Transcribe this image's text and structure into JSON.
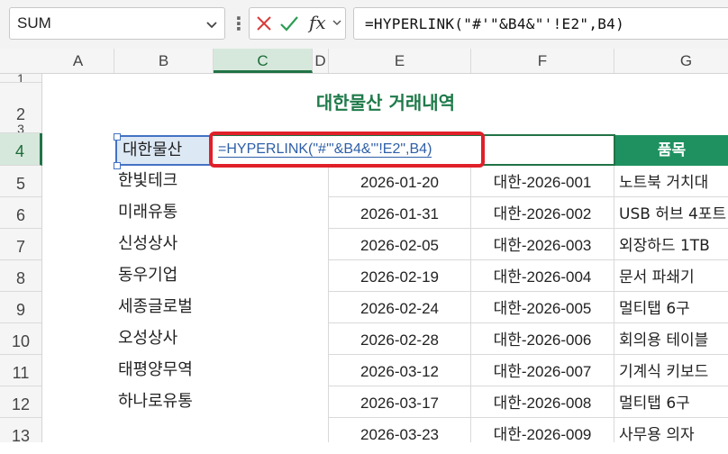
{
  "formula_bar": {
    "name_box": "SUM",
    "fx_label": "fx",
    "formula": "=HYPERLINK(\"#'\"&B4&\"'!E2\",B4)"
  },
  "columns": [
    "A",
    "B",
    "C",
    "D",
    "E",
    "F",
    "G"
  ],
  "selected_column": "C",
  "rows": [
    "1",
    "2",
    "3",
    "4",
    "5",
    "6",
    "7",
    "8",
    "9",
    "10",
    "11",
    "12",
    "13"
  ],
  "selected_row": "4",
  "sheet": {
    "title": "대한물산 거래내역",
    "b4": "대한물산",
    "c4_edit": {
      "part1": "=HYPERLINK(",
      "part2": "\"#'\"",
      "part3": "&B4&",
      "part4": "\"'!E2\"",
      "part5": ",B4)"
    },
    "g4_header": "품목",
    "names": [
      "한빛테크",
      "미래유통",
      "신성상사",
      "동우기업",
      "세종글로벌",
      "오성상사",
      "태평양무역",
      "하나로유통"
    ],
    "dates": [
      "2026-01-20",
      "2026-01-31",
      "2026-02-05",
      "2026-02-19",
      "2026-02-24",
      "2026-02-28",
      "2026-03-12",
      "2026-03-17",
      "2026-03-23"
    ],
    "codes": [
      "대한-2026-001",
      "대한-2026-002",
      "대한-2026-003",
      "대한-2026-004",
      "대한-2026-005",
      "대한-2026-006",
      "대한-2026-007",
      "대한-2026-008",
      "대한-2026-009"
    ],
    "items": [
      "노트북 거치대",
      "USB 허브 4포트",
      "외장하드 1TB",
      "문서 파쇄기",
      "멀티탭 6구",
      "회의용 테이블",
      "기계식 키보드",
      "멀티탭 6구",
      "사무용 의자"
    ]
  },
  "colors": {
    "accent_green": "#217346",
    "header_fill": "#1f9160",
    "title_green": "#1f7a4a",
    "highlight_red": "#e0202a",
    "selection_blue": "#4472c4"
  }
}
